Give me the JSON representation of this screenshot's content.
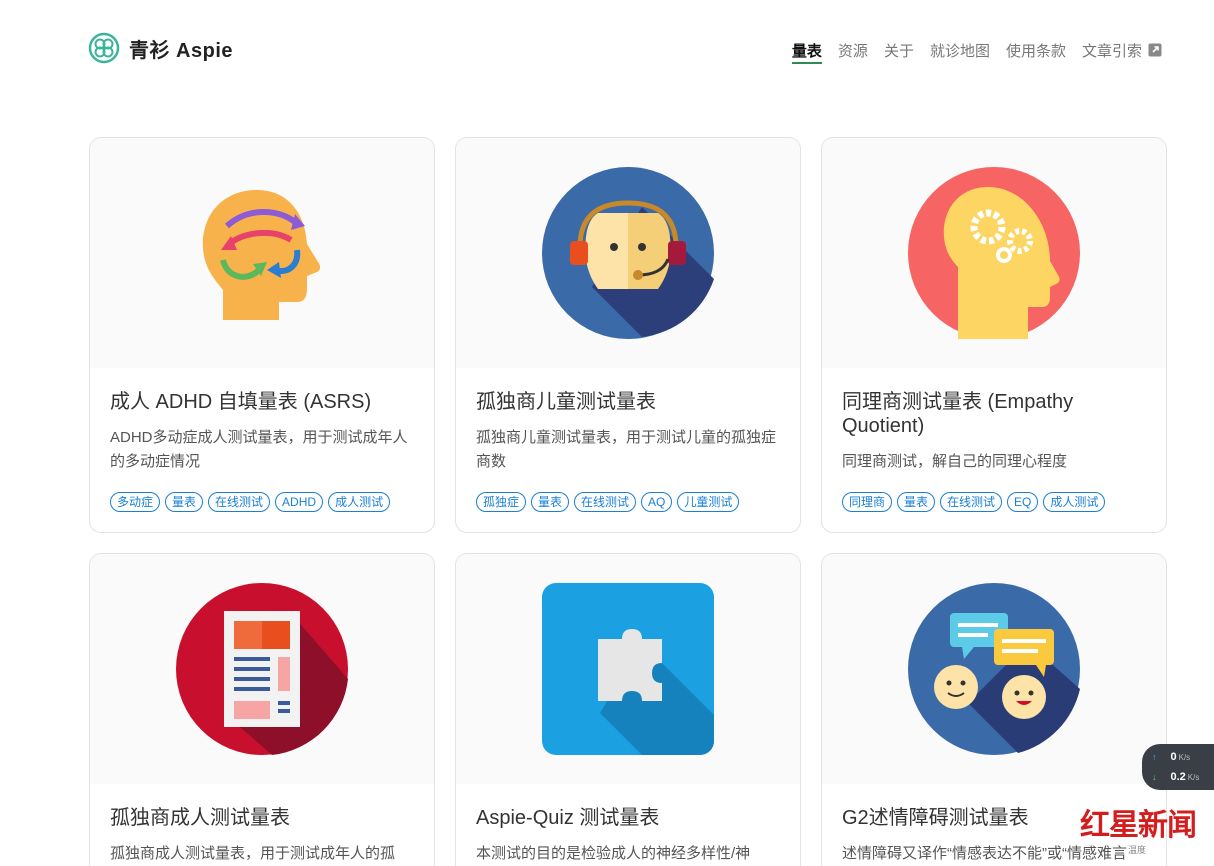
{
  "header": {
    "brand": "青衫 Aspie",
    "nav": [
      "量表",
      "资源",
      "关于",
      "就诊地图",
      "使用条款",
      "文章引索"
    ]
  },
  "cards": [
    {
      "title": "成人 ADHD 自填量表 (ASRS)",
      "desc": "ADHD多动症成人测试量表，用于测试成年人的多动症情况",
      "tags": [
        "多动症",
        "量表",
        "在线测试",
        "ADHD",
        "成人测试"
      ]
    },
    {
      "title": "孤独商儿童测试量表",
      "desc": "孤独商儿童测试量表，用于测试儿童的孤独症商数",
      "tags": [
        "孤独症",
        "量表",
        "在线测试",
        "AQ",
        "儿童测试"
      ]
    },
    {
      "title": "同理商测试量表 (Empathy Quotient)",
      "desc": "同理商测试，解自己的同理心程度",
      "tags": [
        "同理商",
        "量表",
        "在线测试",
        "EQ",
        "成人测试"
      ]
    },
    {
      "title": "孤独商成人测试量表",
      "desc": "孤独商成人测试量表，用于测试成年人的孤",
      "tags": []
    },
    {
      "title": "Aspie-Quiz 测试量表",
      "desc": "本测试的目的是检验成人的神经多样性/神",
      "tags": []
    },
    {
      "title": "G2述情障碍测试量表",
      "desc": "述情障碍又译作“情感表达不能”或“情感难言",
      "tags": []
    }
  ],
  "widget": {
    "upload": "0",
    "upload_unit": "K/s",
    "download": "0.2",
    "download_unit": "K/s"
  },
  "watermark": {
    "text": "红星新闻",
    "small": "温度"
  },
  "colors": {
    "accent": "#2e8b57",
    "tag": "#1a7fd4"
  }
}
